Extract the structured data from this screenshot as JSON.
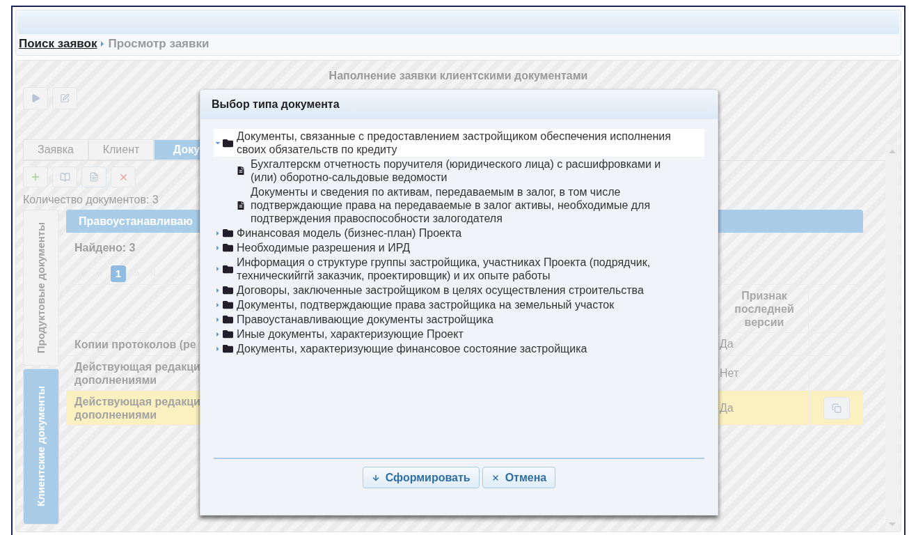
{
  "breadcrumb": [
    {
      "label": "Поиск заявок",
      "kind": "link"
    },
    {
      "label": "Просмотр заявки",
      "kind": "current"
    }
  ],
  "page": {
    "title": "Наполнение заявки клиентскими документами",
    "tabs": [
      {
        "label": "Заявка",
        "selected": false
      },
      {
        "label": "Клиент",
        "selected": false
      },
      {
        "label": "Доку",
        "selected": true
      }
    ],
    "document_count": "Количество документов: 3",
    "side_tabs": [
      {
        "label": "Продуктовые документы",
        "selected": false
      },
      {
        "label": "Клиентские документы",
        "selected": true
      }
    ],
    "panel_title": "Правоустанавливаю",
    "found": "Найдено: 3",
    "pager": [
      {
        "label": "1",
        "selected": true
      }
    ],
    "table": {
      "header": "Признак последней версии",
      "rows": [
        {
          "name": "Копии протоколов (ре",
          "last_version": "Да",
          "selected": false,
          "has_action": false
        },
        {
          "name": "Действующая редакци дополнениями",
          "last_version": "Нет",
          "selected": false,
          "has_action": false
        },
        {
          "name": "Действующая редакци дополнениями",
          "last_version": "Да",
          "selected": true,
          "has_action": true
        }
      ]
    }
  },
  "dialog": {
    "title": "Выбор типа документа",
    "tree": [
      {
        "kind": "folder",
        "label": "Документы, связанные с предоставлением застройщиком обеспечения исполнения своих обязательств по кредиту",
        "expanded": true,
        "selected": true,
        "children": [
          {
            "kind": "file",
            "label": "Бухгалтерскм отчетность поручителя (юридического лица) с расшифровками и (или) оборотно-сальдовые ведомости"
          },
          {
            "kind": "file",
            "label": "Документы и сведения по активам, передаваемым в залог, в том числе подтверждающие права на передаваемые в залог активы, необходимые для подтверждения правоспособности залогодателя"
          }
        ]
      },
      {
        "kind": "folder",
        "label": "Финансовая модель (бизнес-план) Проекта",
        "expanded": false,
        "selected": false
      },
      {
        "kind": "folder",
        "label": "Необходимые разрешения и ИРД",
        "expanded": false,
        "selected": false
      },
      {
        "kind": "folder",
        "label": "Информация о структуре группы застройщика, участниках Проекта (подрядчик, техническийrrй заказчик, проектировщик) и их опыте работы",
        "expanded": false,
        "selected": false
      },
      {
        "kind": "folder",
        "label": "Договоры, заключенные застройщиком в целях осуществления строительства",
        "expanded": false,
        "selected": false
      },
      {
        "kind": "folder",
        "label": "Документы, подтверждающие права застройщика на земельный участок",
        "expanded": false,
        "selected": false
      },
      {
        "kind": "folder",
        "label": "Правоустанавливающие документы застройщика",
        "expanded": false,
        "selected": false
      },
      {
        "kind": "folder",
        "label": "Иные документы, характеризующие Проект",
        "expanded": false,
        "selected": false
      },
      {
        "kind": "folder",
        "label": "Документы, характеризующие финансовое состояние застройщика",
        "expanded": false,
        "selected": false
      }
    ],
    "buttons": [
      {
        "label": "Сформировать",
        "kind": "generate"
      },
      {
        "label": "Отмена",
        "kind": "cancel"
      }
    ]
  }
}
